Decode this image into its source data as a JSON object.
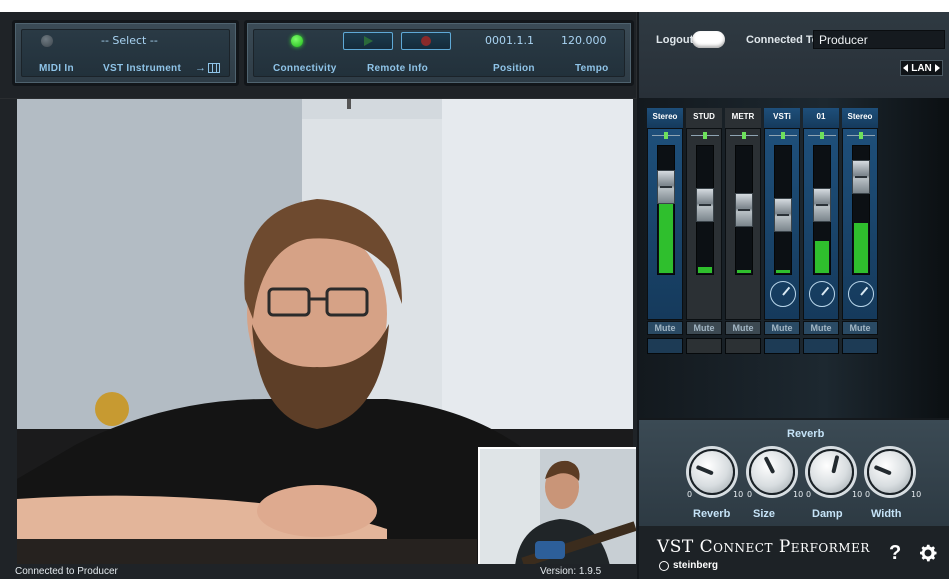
{
  "midi_panel": {
    "select_value": "-- Select --",
    "midi_in_label": "MIDI In",
    "vst_instrument_label": "VST Instrument",
    "keyboard_arrow": "→"
  },
  "transport_panel": {
    "connectivity_label": "Connectivity",
    "remote_info_label": "Remote Info",
    "position_label": "Position",
    "position_value": "0001.1.1",
    "tempo_label": "Tempo",
    "tempo_value": "120.000"
  },
  "connection": {
    "logout_label": "Logout",
    "connected_to_label": "Connected To",
    "connected_to_value": "Producer",
    "lan_label": "LAN"
  },
  "mixer": {
    "channels": [
      {
        "name": "Stereo",
        "mute": "Mute"
      },
      {
        "name": "STUD",
        "mute": "Mute"
      },
      {
        "name": "METR",
        "mute": "Mute"
      },
      {
        "name": "VSTi",
        "mute": "Mute"
      },
      {
        "name": "01",
        "mute": "Mute"
      },
      {
        "name": "Stereo",
        "mute": "Mute"
      }
    ],
    "meter_levels": [
      0.55,
      0.05,
      0.02,
      0.02,
      0.25,
      0.4
    ],
    "fader_levels": [
      0.75,
      0.55,
      0.5,
      0.45,
      0.55,
      0.85
    ]
  },
  "reverb": {
    "title": "Reverb",
    "knobs": [
      {
        "label": "Reverb",
        "value": 0.25
      },
      {
        "label": "Size",
        "value": 0.4
      },
      {
        "label": "Damp",
        "value": 0.55
      },
      {
        "label": "Width",
        "value": 0.25
      }
    ],
    "scale_min": "0",
    "scale_max": "10"
  },
  "brand": {
    "title": "VST Connect Performer",
    "company": "steinberg",
    "help_label": "?"
  },
  "status": {
    "left": "Connected to Producer",
    "version": "Version: 1.9.5"
  },
  "colors": {
    "accent_blue": "#8fc4e8",
    "led_green": "#39e433",
    "meter_green": "#2fbf2d"
  }
}
